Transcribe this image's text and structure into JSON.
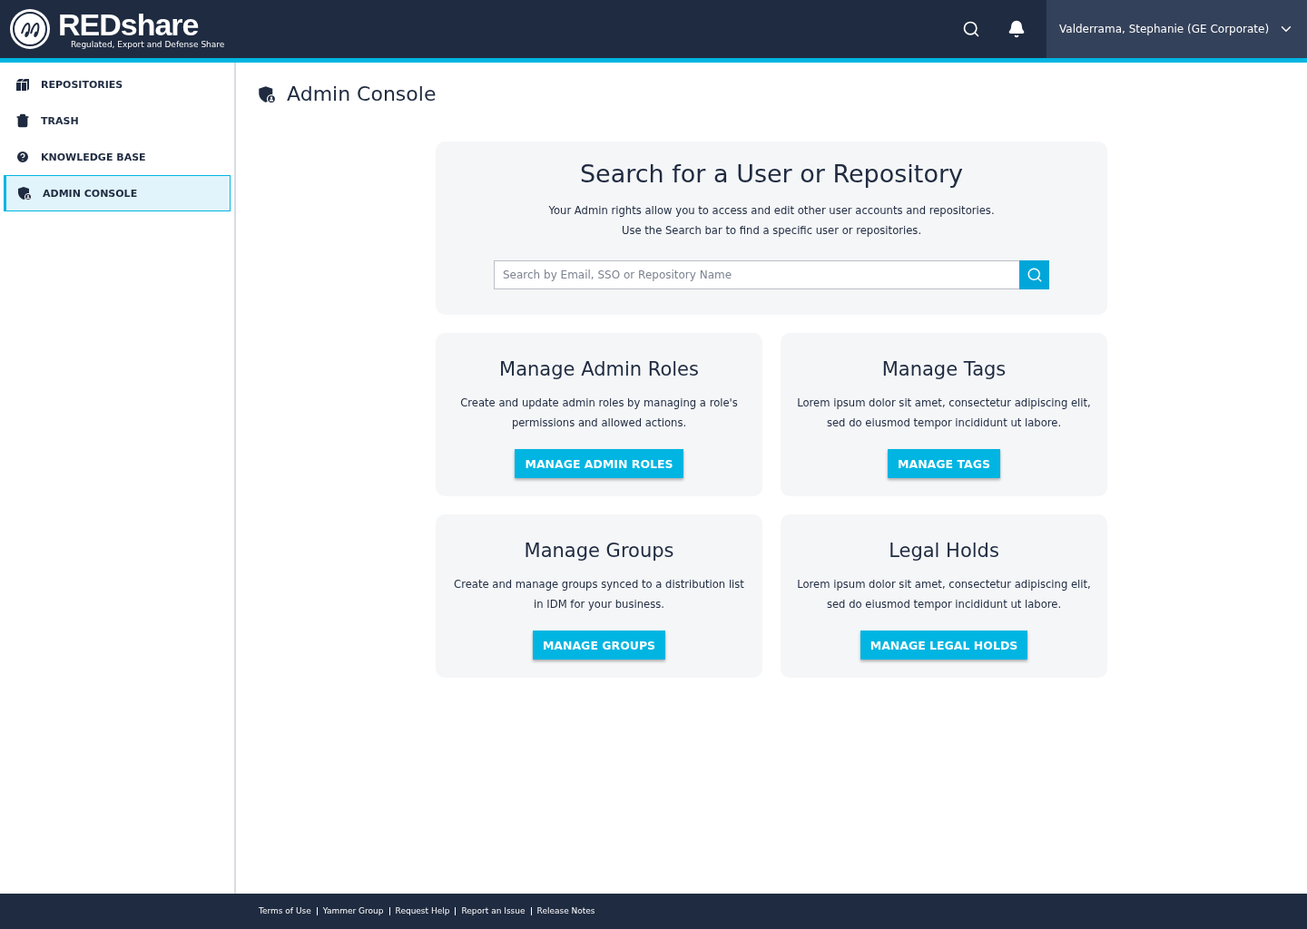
{
  "header": {
    "brand": "REDshare",
    "tagline": "Regulated, Export and Defense Share",
    "user": "Valderrama, Stephanie (GE Corporate)"
  },
  "sidebar": {
    "items": [
      {
        "label": "REPOSITORIES",
        "selected": false
      },
      {
        "label": "TRASH",
        "selected": false
      },
      {
        "label": "KNOWLEDGE BASE",
        "selected": false
      },
      {
        "label": "ADMIN CONSOLE",
        "selected": true
      }
    ]
  },
  "page_title": "Admin Console",
  "search_card": {
    "title": "Search for a User or Repository",
    "lines": [
      "Your Admin rights allow you to access and edit other user accounts and repositories.",
      "Use the Search bar to find a specific user or repositories."
    ],
    "placeholder": "Search by Email, SSO or Repository Name"
  },
  "cards": [
    {
      "title": "Manage Admin Roles",
      "text": "Create and update admin roles by managing a role's permissions and allowed actions.",
      "button": "MANAGE ADMIN ROLES"
    },
    {
      "title": "Manage Tags",
      "text": "Lorem ipsum dolor sit amet, consectetur adipiscing elit, sed do eiusmod tempor incididunt ut labore.",
      "button": "MANAGE TAGS"
    },
    {
      "title": "Manage Groups",
      "text": "Create and manage groups synced to a distribution list in IDM for your business.",
      "button": "MANAGE GROUPS"
    },
    {
      "title": "Legal Holds",
      "text": "Lorem ipsum dolor sit amet, consectetur adipiscing elit, sed do eiusmod tempor incididunt ut labore.",
      "button": "MANAGE LEGAL HOLDS"
    }
  ],
  "footer": {
    "links": [
      "Terms of Use",
      "Yammer Group",
      "Request Help",
      "Report an Issue",
      "Release Notes"
    ]
  }
}
